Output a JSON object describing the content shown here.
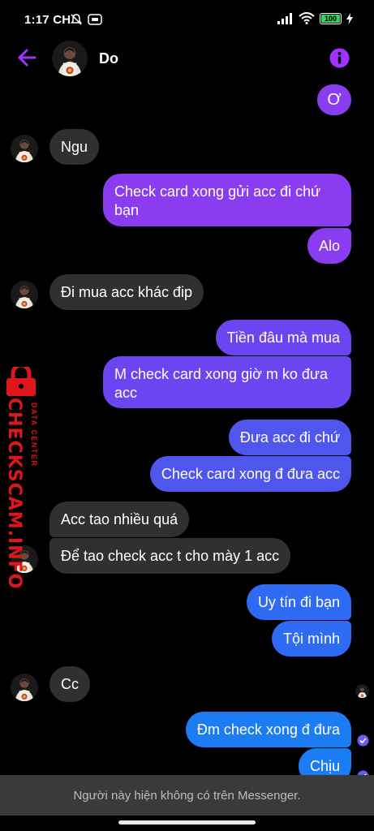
{
  "status_bar": {
    "time": "1:17 CH",
    "badge": "",
    "battery": "100"
  },
  "header": {
    "contact_name": "Do"
  },
  "messages": [
    {
      "dir": "out",
      "text": "Ơ"
    },
    {
      "dir": "in",
      "text": "Ngu"
    },
    {
      "dir": "out",
      "text": "Check card xong gửi acc đi chứ bạn"
    },
    {
      "dir": "out",
      "text": "Alo"
    },
    {
      "dir": "in",
      "text": "Đi mua acc khác đip"
    },
    {
      "dir": "out",
      "text": "Tiền đâu mà mua"
    },
    {
      "dir": "out",
      "text": "M check card xong giờ m ko đưa acc"
    },
    {
      "dir": "out",
      "text": "Đưa acc đi chứ"
    },
    {
      "dir": "out",
      "text": "Check card xong đ đưa acc"
    },
    {
      "dir": "in",
      "text": "Acc tao nhiều quá"
    },
    {
      "dir": "in",
      "text": "Để tao check acc t cho mày 1 acc"
    },
    {
      "dir": "out",
      "text": "Uy tín đi bạn"
    },
    {
      "dir": "out",
      "text": "Tội mình"
    },
    {
      "dir": "in",
      "text": "Cc"
    },
    {
      "dir": "out",
      "text": "Đm check xong đ đưa"
    },
    {
      "dir": "out",
      "text": "Chịu"
    }
  ],
  "footer": {
    "notice": "Người này hiện không có trên Messenger."
  },
  "watermark": {
    "main": "CHECKSCAM.INFO",
    "sub": "DATA CENTER"
  },
  "colors": {
    "accent": "#a033ff",
    "incoming_bubble": "#303030",
    "outgoing_top": "#8a3cf0",
    "outgoing_bottom": "#1c7cf4",
    "watermark": "#e0161b"
  },
  "icons": {
    "back": "arrow-left-icon",
    "info": "info-icon",
    "mute": "bell-off-icon",
    "signal": "signal-icon",
    "wifi": "wifi-icon",
    "charging": "bolt-icon"
  }
}
